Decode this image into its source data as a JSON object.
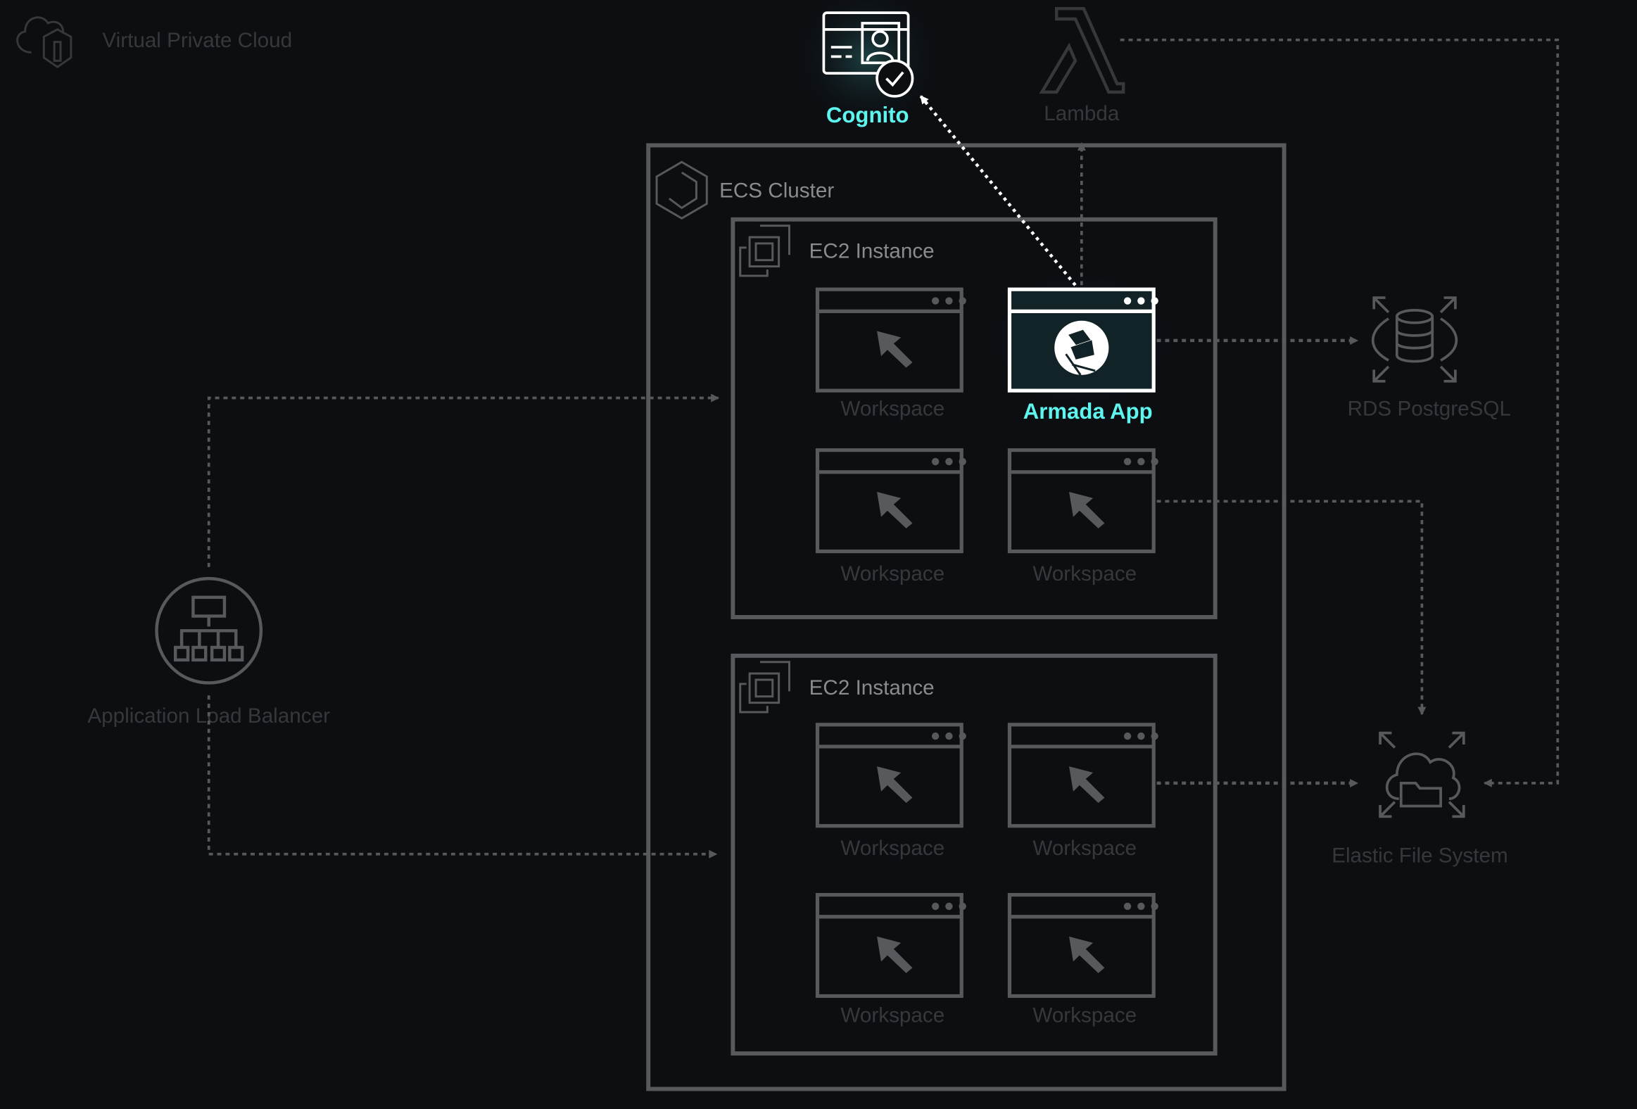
{
  "colors": {
    "background": "#0c0e12",
    "accent": "#5ff5ef",
    "border": "#58595c",
    "dim": "#36383c"
  },
  "vpc": {
    "label": "Virtual Private Cloud",
    "icon": "cloud-shield-icon"
  },
  "cognito": {
    "label": "Cognito",
    "icon": "identity-card-check-icon"
  },
  "lambda": {
    "label": "Lambda",
    "icon": "lambda-icon"
  },
  "ecs": {
    "label": "ECS Cluster",
    "icon": "ecs-hexagon-icon"
  },
  "ec2": [
    {
      "label": "EC2 Instance",
      "icon": "chip-icon",
      "workspaces": [
        {
          "label": "Workspace"
        },
        {
          "label": "Armada App",
          "highlighted": true
        },
        {
          "label": "Workspace"
        },
        {
          "label": "Workspace"
        }
      ]
    },
    {
      "label": "EC2 Instance",
      "icon": "chip-icon",
      "workspaces": [
        {
          "label": "Workspace"
        },
        {
          "label": "Workspace"
        },
        {
          "label": "Workspace"
        },
        {
          "label": "Workspace"
        }
      ]
    }
  ],
  "rds": {
    "label": "RDS PostgreSQL",
    "icon": "database-icon"
  },
  "efs": {
    "label": "Elastic File System",
    "icon": "cloud-folder-icon"
  },
  "alb": {
    "label": "Application Load Balancer",
    "icon": "load-balancer-icon"
  }
}
